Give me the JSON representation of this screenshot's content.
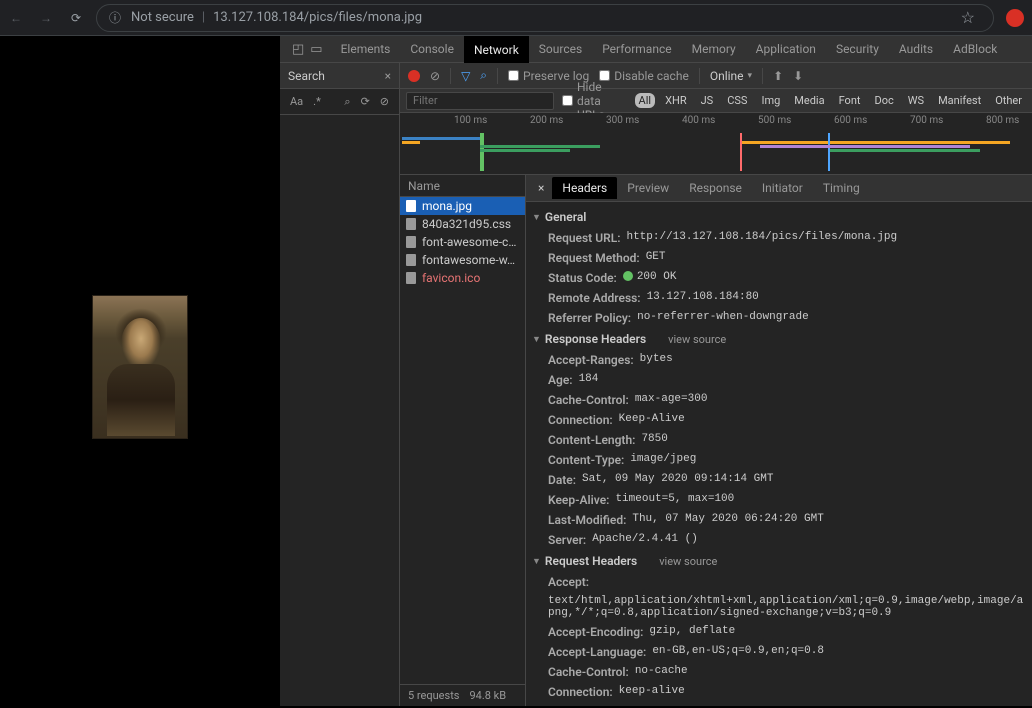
{
  "browser": {
    "not_secure_label": "Not secure",
    "url": "13.127.108.184/pics/files/mona.jpg"
  },
  "devtools": {
    "tabs": [
      "Elements",
      "Console",
      "Network",
      "Sources",
      "Performance",
      "Memory",
      "Application",
      "Security",
      "Audits",
      "AdBlock"
    ],
    "active_tab": "Network"
  },
  "search_panel": {
    "label": "Search",
    "aa": "Aa",
    "regex": ".*"
  },
  "net_toolbar": {
    "preserve_log": "Preserve log",
    "disable_cache": "Disable cache",
    "throttle": "Online"
  },
  "filter_row": {
    "placeholder": "Filter",
    "hide_urls": "Hide data URLs",
    "types": [
      "All",
      "XHR",
      "JS",
      "CSS",
      "Img",
      "Media",
      "Font",
      "Doc",
      "WS",
      "Manifest",
      "Other"
    ]
  },
  "timeline": {
    "ticks": [
      "100 ms",
      "200 ms",
      "300 ms",
      "400 ms",
      "500 ms",
      "600 ms",
      "700 ms",
      "800 ms"
    ]
  },
  "requests": {
    "head": "Name",
    "items": [
      {
        "name": "mona.jpg",
        "selected": true
      },
      {
        "name": "840a321d95.css"
      },
      {
        "name": "font-awesome-c…"
      },
      {
        "name": "fontawesome-w…"
      },
      {
        "name": "favicon.ico",
        "red": true
      }
    ],
    "status": {
      "count": "5 requests",
      "size": "94.8 kB"
    }
  },
  "detail": {
    "tabs": [
      "Headers",
      "Preview",
      "Response",
      "Initiator",
      "Timing"
    ],
    "active": "Headers",
    "general_label": "General",
    "general": [
      {
        "k": "Request URL:",
        "v": "http://13.127.108.184/pics/files/mona.jpg"
      },
      {
        "k": "Request Method:",
        "v": "GET"
      },
      {
        "k": "Status Code:",
        "v": "200 OK",
        "status": true
      },
      {
        "k": "Remote Address:",
        "v": "13.127.108.184:80"
      },
      {
        "k": "Referrer Policy:",
        "v": "no-referrer-when-downgrade"
      }
    ],
    "response_headers_label": "Response Headers",
    "view_source": "view source",
    "response_headers": [
      {
        "k": "Accept-Ranges:",
        "v": "bytes"
      },
      {
        "k": "Age:",
        "v": "184"
      },
      {
        "k": "Cache-Control:",
        "v": "max-age=300"
      },
      {
        "k": "Connection:",
        "v": "Keep-Alive"
      },
      {
        "k": "Content-Length:",
        "v": "7850"
      },
      {
        "k": "Content-Type:",
        "v": "image/jpeg"
      },
      {
        "k": "Date:",
        "v": "Sat, 09 May 2020 09:14:14 GMT"
      },
      {
        "k": "Keep-Alive:",
        "v": "timeout=5, max=100"
      },
      {
        "k": "Last-Modified:",
        "v": "Thu, 07 May 2020 06:24:20 GMT"
      },
      {
        "k": "Server:",
        "v": "Apache/2.4.41 ()"
      }
    ],
    "request_headers_label": "Request Headers",
    "request_headers": [
      {
        "k": "Accept:",
        "v": "text/html,application/xhtml+xml,application/xml;q=0.9,image/webp,image/apng,*/*;q=0.8,application/signed-exchange;v=b3;q=0.9"
      },
      {
        "k": "Accept-Encoding:",
        "v": "gzip, deflate"
      },
      {
        "k": "Accept-Language:",
        "v": "en-GB,en-US;q=0.9,en;q=0.8"
      },
      {
        "k": "Cache-Control:",
        "v": "no-cache"
      },
      {
        "k": "Connection:",
        "v": "keep-alive"
      }
    ]
  }
}
